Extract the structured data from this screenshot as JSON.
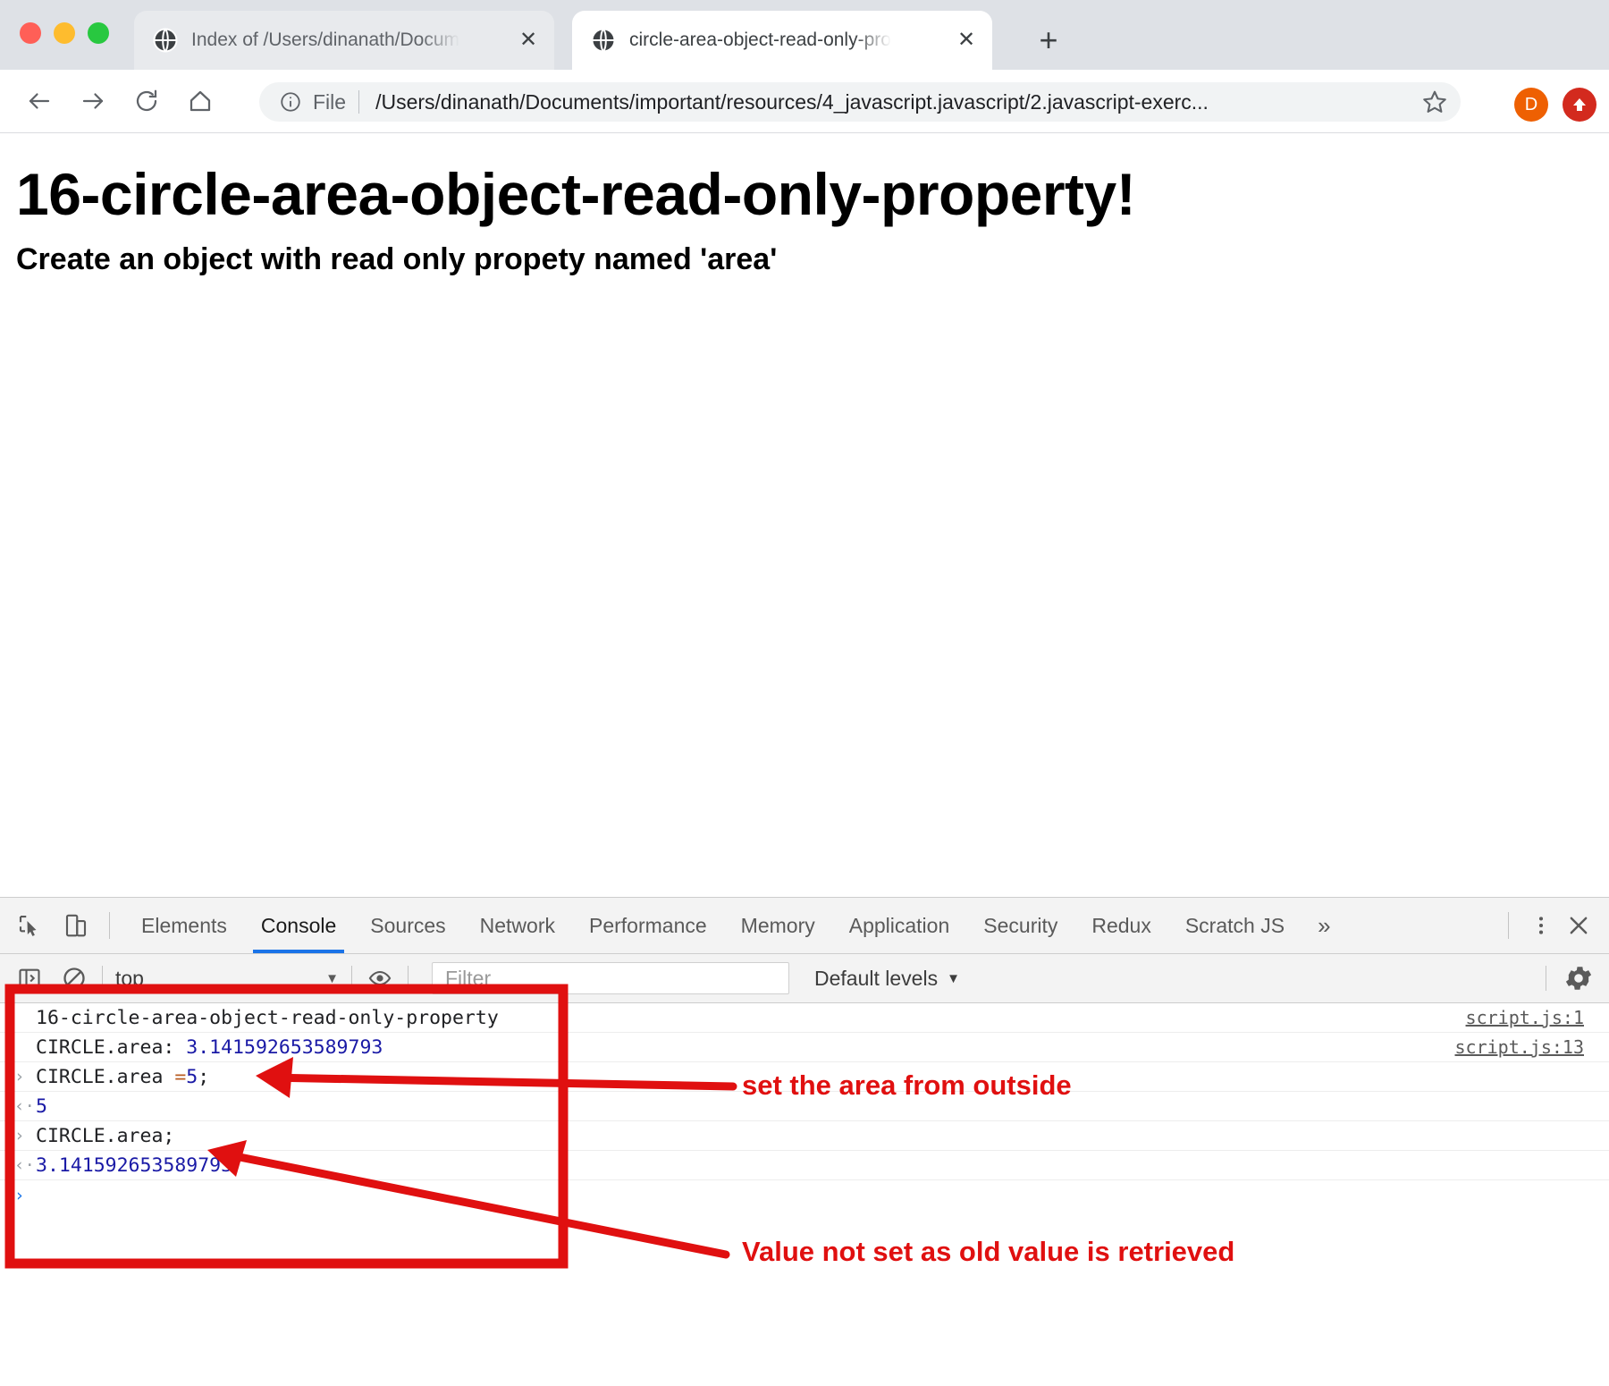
{
  "browser": {
    "traffic_lights": [
      "close",
      "minimize",
      "zoom"
    ],
    "tabs": [
      {
        "title": "Index of /Users/dinanath/Docum",
        "favicon": "globe-icon",
        "active": false,
        "close_label": "✕"
      },
      {
        "title": "circle-area-object-read-only-pro",
        "favicon": "globe-icon",
        "active": true,
        "close_label": "✕"
      }
    ],
    "new_tab_label": "+",
    "toolbar": {
      "back_icon": "back-arrow-icon",
      "forward_icon": "forward-arrow-icon",
      "reload_icon": "reload-icon",
      "home_icon": "home-icon",
      "info_icon": "info-circle-icon",
      "scheme_label": "File",
      "url": "/Users/dinanath/Documents/important/resources/4_javascript.javascript/2.javascript-exerc...",
      "bookmark_icon": "star-icon",
      "avatar_letter": "D",
      "avatar_color": "#ee6002",
      "extension_icon": "red-upload-badge-icon",
      "extension_color": "#d32a1e"
    }
  },
  "page": {
    "heading": "16-circle-area-object-read-only-property!",
    "subheading": "Create an object with read only propety named 'area'"
  },
  "devtools": {
    "inspect_icon": "inspect-element-icon",
    "device_icon": "device-toolbar-icon",
    "tabs": [
      {
        "label": "Elements",
        "selected": false
      },
      {
        "label": "Console",
        "selected": true
      },
      {
        "label": "Sources",
        "selected": false
      },
      {
        "label": "Network",
        "selected": false
      },
      {
        "label": "Performance",
        "selected": false
      },
      {
        "label": "Memory",
        "selected": false
      },
      {
        "label": "Application",
        "selected": false
      },
      {
        "label": "Security",
        "selected": false
      },
      {
        "label": "Redux",
        "selected": false
      },
      {
        "label": "Scratch JS",
        "selected": false
      }
    ],
    "overflow_label": "»",
    "kebab_icon": "more-options-icon",
    "close_icon": "close-devtools-icon",
    "filterbar": {
      "sidebar_icon": "console-sidebar-icon",
      "clear_icon": "clear-console-icon",
      "context": "top",
      "context_caret": "▼",
      "eye_icon": "live-expression-eye-icon",
      "filter_placeholder": "Filter",
      "filter_value": "",
      "levels_label": "Default levels",
      "levels_caret": "▼",
      "settings_icon": "gear-icon"
    },
    "console_rows": [
      {
        "gutter": "",
        "type": "log",
        "text": "16-circle-area-object-read-only-property",
        "source": "script.js:1"
      },
      {
        "gutter": "",
        "type": "log-value",
        "label": "CIRCLE.area: ",
        "value": "3.141592653589793",
        "source": "script.js:13"
      },
      {
        "gutter": "›",
        "type": "input-assign",
        "expr_left": "CIRCLE.area ",
        "expr_op": "= ",
        "expr_num": "5",
        "expr_end": ";",
        "source": ""
      },
      {
        "gutter": "‹·",
        "type": "result-number",
        "value": "5",
        "source": ""
      },
      {
        "gutter": "›",
        "type": "input",
        "text": "CIRCLE.area;",
        "source": ""
      },
      {
        "gutter": "‹·",
        "type": "result-number",
        "value": "3.141592653589793",
        "source": ""
      },
      {
        "gutter": "›",
        "type": "prompt",
        "text": "",
        "source": ""
      }
    ]
  },
  "annotations": {
    "color": "#e01010",
    "highlight_box": {
      "label": "console-output-highlight-box"
    },
    "notes": [
      {
        "text": "set the area from outside",
        "name": "annotation-set-area"
      },
      {
        "text": "Value not set as old value is retrieved",
        "name": "annotation-value-not-set"
      }
    ]
  }
}
